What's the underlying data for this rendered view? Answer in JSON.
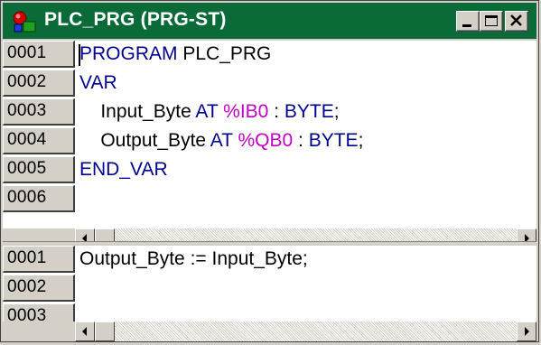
{
  "window": {
    "title": "PLC_PRG (PRG-ST)",
    "titlebar_color": "#0a6b39",
    "icon": "pou-icon"
  },
  "declaration": {
    "lines": [
      {
        "no": "0001",
        "parts": [
          {
            "t": "PROGRAM",
            "c": "kw"
          },
          {
            "t": " PLC_PRG",
            "c": ""
          }
        ]
      },
      {
        "no": "0002",
        "parts": [
          {
            "t": "VAR",
            "c": "kw"
          }
        ]
      },
      {
        "no": "0003",
        "parts": [
          {
            "t": "    Input_Byte ",
            "c": ""
          },
          {
            "t": "AT",
            "c": "kw"
          },
          {
            "t": " %IB0",
            "c": "addr"
          },
          {
            "t": " : ",
            "c": ""
          },
          {
            "t": "BYTE",
            "c": "kw"
          },
          {
            "t": ";",
            "c": ""
          }
        ]
      },
      {
        "no": "0004",
        "parts": [
          {
            "t": "    Output_Byte ",
            "c": ""
          },
          {
            "t": "AT",
            "c": "kw"
          },
          {
            "t": " %QB0",
            "c": "addr"
          },
          {
            "t": " : ",
            "c": ""
          },
          {
            "t": "BYTE",
            "c": "kw"
          },
          {
            "t": ";",
            "c": ""
          }
        ]
      },
      {
        "no": "0005",
        "parts": [
          {
            "t": "END_VAR",
            "c": "kw"
          }
        ]
      },
      {
        "no": "0006",
        "parts": []
      }
    ]
  },
  "body": {
    "lines": [
      {
        "no": "0001",
        "parts": [
          {
            "t": "Output_Byte := Input_Byte;",
            "c": ""
          }
        ]
      },
      {
        "no": "0002",
        "parts": []
      },
      {
        "no": "0003",
        "parts": []
      }
    ]
  },
  "colors": {
    "keyword": "#00008b",
    "address": "#c000c0"
  }
}
